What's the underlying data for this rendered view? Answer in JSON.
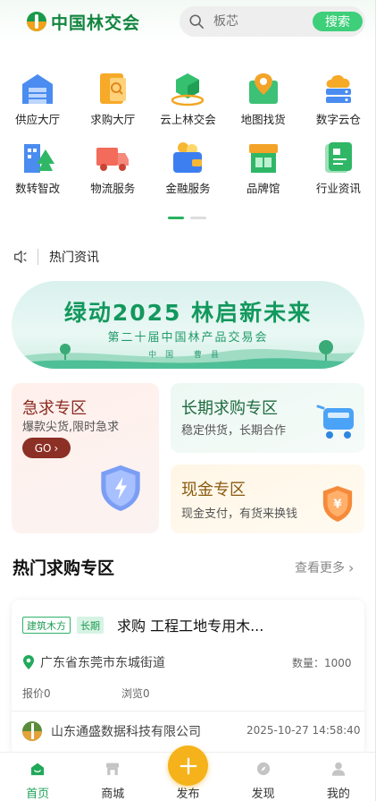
{
  "header": {
    "logo_text": "中国林交会",
    "search_placeholder": "板芯",
    "search_button": "搜索"
  },
  "categories": [
    {
      "label": "供应大厅",
      "icon": "warehouse-icon"
    },
    {
      "label": "求购大厅",
      "icon": "purchase-doc-icon"
    },
    {
      "label": "云上林交会",
      "icon": "cloud-box-icon"
    },
    {
      "label": "地图找货",
      "icon": "map-pin-icon"
    },
    {
      "label": "数字云仓",
      "icon": "cloud-storage-icon"
    },
    {
      "label": "数转智改",
      "icon": "digital-building-icon"
    },
    {
      "label": "物流服务",
      "icon": "truck-icon"
    },
    {
      "label": "金融服务",
      "icon": "wallet-icon"
    },
    {
      "label": "品牌馆",
      "icon": "brand-store-icon"
    },
    {
      "label": "行业资讯",
      "icon": "news-doc-icon"
    }
  ],
  "news": {
    "title": "热门资讯"
  },
  "banner": {
    "title": "绿动2025  林启新未来",
    "subtitle": "第二十届中国林产品交易会",
    "tiny": "中国 曹县"
  },
  "zones": {
    "urgent": {
      "title": "急求专区",
      "desc": "爆款尖货,限时急求",
      "button": "GO"
    },
    "long_term": {
      "title": "长期求购专区",
      "desc": "稳定供货，长期合作"
    },
    "cash": {
      "title": "现金专区",
      "desc": "现金支付，有货来换钱"
    }
  },
  "hot_section": {
    "title": "热门求购专区",
    "more": "查看更多"
  },
  "listing": {
    "tag_type": "建筑木方",
    "tag_term": "长期",
    "title": "求购 工程工地专用木...",
    "location": "广东省东莞市东城街道",
    "quantity": "数量：1000",
    "quote": "报价0",
    "views": "浏览0",
    "company": "山东通盛数据科技有限公司",
    "time": "2025-10-27 14:58:40"
  },
  "tabbar": [
    {
      "label": "首页",
      "icon": "home-icon",
      "active": true
    },
    {
      "label": "商城",
      "icon": "store-icon",
      "active": false
    },
    {
      "label": "发布",
      "icon": "plus-icon",
      "active": false
    },
    {
      "label": "发现",
      "icon": "compass-icon",
      "active": false
    },
    {
      "label": "我的",
      "icon": "user-icon",
      "active": false
    }
  ],
  "colors": {
    "brand": "#12853f",
    "accent": "#3ecf7a",
    "publish": "#f5b21a"
  }
}
